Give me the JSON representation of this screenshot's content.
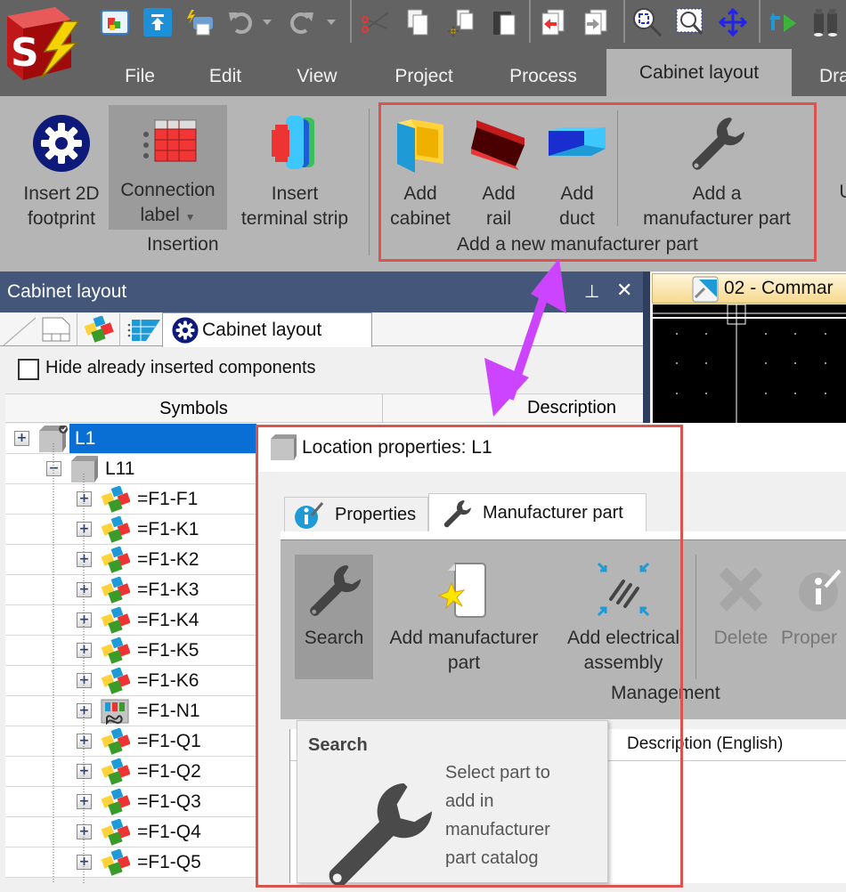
{
  "app": {
    "logo": "SOLIDWORKS Electrical logo",
    "quick_access_icons": [
      "project-manager-icon",
      "upload-icon",
      "print-icon",
      "undo-icon",
      "undo-dropdown-icon",
      "redo-icon",
      "redo-dropdown-icon",
      "cut-icon",
      "copy-icon",
      "copy-base-point-icon",
      "paste-icon",
      "previous-drawing-icon",
      "next-drawing-icon",
      "zoom-extents-icon",
      "zoom-window-icon",
      "pan-icon",
      "go-to-icon",
      "find-icon"
    ]
  },
  "menu": {
    "items": [
      "File",
      "Edit",
      "View",
      "Project",
      "Process",
      "Cabinet layout",
      "Dra"
    ],
    "active": "Cabinet layout"
  },
  "ribbon": {
    "insertion": {
      "insert_2d_footprint": [
        "Insert 2D",
        "footprint"
      ],
      "connection_label": [
        "Connection",
        "label"
      ],
      "insert_terminal_strip": [
        "Insert",
        "terminal strip"
      ],
      "group_label": "Insertion"
    },
    "add_new_part": {
      "add_cabinet": [
        "Add",
        "cabinet"
      ],
      "add_rail": [
        "Add",
        "rail"
      ],
      "add_duct": [
        "Add",
        "duct"
      ],
      "add_manufacturer_part": [
        "Add a",
        "manufacturer part"
      ],
      "group_label": "Add a new manufacturer part"
    },
    "cut_off_label": "U"
  },
  "panel": {
    "title": "Cabinet layout",
    "active_tab_label": "Cabinet layout",
    "hide_checkbox_label": "Hide already inserted components",
    "hide_checked": false,
    "columns": [
      "Symbols",
      "Description"
    ],
    "tree": {
      "root": "L1",
      "child": "L11",
      "items": [
        {
          "label": "=F1-F1",
          "icon": "component"
        },
        {
          "label": "=F1-K1",
          "icon": "component"
        },
        {
          "label": "=F1-K2",
          "icon": "component"
        },
        {
          "label": "=F1-K3",
          "icon": "component"
        },
        {
          "label": "=F1-K4",
          "icon": "component"
        },
        {
          "label": "=F1-K5",
          "icon": "component"
        },
        {
          "label": "=F1-K6",
          "icon": "component"
        },
        {
          "label": "=F1-N1",
          "icon": "plc"
        },
        {
          "label": "=F1-Q1",
          "icon": "component"
        },
        {
          "label": "=F1-Q2",
          "icon": "component"
        },
        {
          "label": "=F1-Q3",
          "icon": "component"
        },
        {
          "label": "=F1-Q4",
          "icon": "component"
        },
        {
          "label": "=F1-Q5",
          "icon": "component"
        }
      ]
    }
  },
  "drawing": {
    "tab_label": "02 - Commar"
  },
  "dialog": {
    "title": "Location properties: L1",
    "tabs": [
      "Properties",
      "Manufacturer part"
    ],
    "active_tab": "Manufacturer part",
    "buttons": {
      "search": "Search",
      "add_manufacturer_part": [
        "Add manufacturer",
        "part"
      ],
      "add_electrical_assembly": [
        "Add electrical",
        "assembly"
      ],
      "delete": "Delete",
      "properties": "Proper"
    },
    "group_label": "Management",
    "grid_header": "Description (English)",
    "tooltip": {
      "title": "Search",
      "text_lines": [
        "Select part to",
        "add in",
        "manufacturer",
        "part catalog"
      ]
    }
  },
  "colors": {
    "annotation_frame": "#d9534f",
    "annotation_arrow": "#cc44ff",
    "selection": "#0a6fd4",
    "panel_title": "#445679"
  }
}
